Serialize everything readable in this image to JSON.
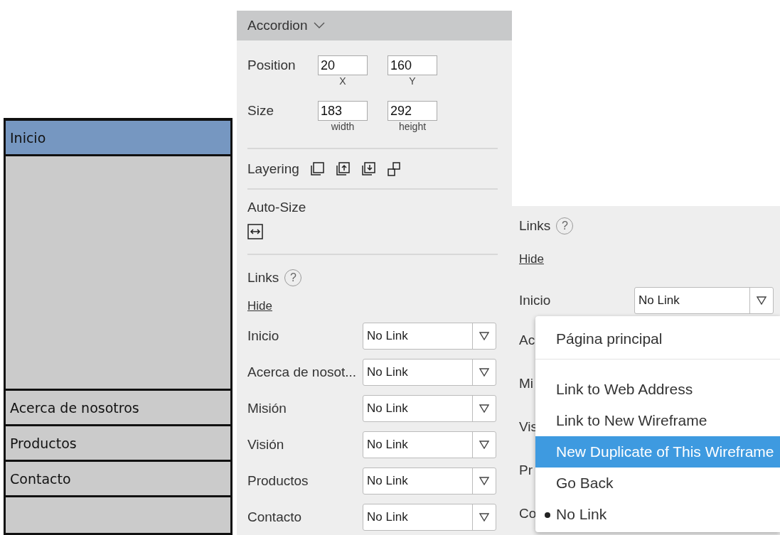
{
  "accordion": {
    "items": [
      {
        "label": "Inicio",
        "selected": true
      },
      {
        "label": "Acerca de nosotros",
        "selected": false
      },
      {
        "label": "Productos",
        "selected": false
      },
      {
        "label": "Contacto",
        "selected": false
      }
    ]
  },
  "inspector": {
    "title": "Accordion",
    "position": {
      "label": "Position",
      "fields": [
        {
          "value": "20",
          "caption": "X"
        },
        {
          "value": "160",
          "caption": "Y"
        }
      ]
    },
    "size": {
      "label": "Size",
      "fields": [
        {
          "value": "183",
          "caption": "width"
        },
        {
          "value": "292",
          "caption": "height"
        }
      ]
    },
    "layering": {
      "label": "Layering"
    },
    "auto_size": {
      "label": "Auto-Size"
    },
    "links": {
      "label": "Links",
      "help": "?",
      "hide": "Hide",
      "rows": [
        {
          "label": "Inicio",
          "value": "No Link"
        },
        {
          "label": "Acerca de nosot...",
          "value": "No Link"
        },
        {
          "label": "Misión",
          "value": "No Link"
        },
        {
          "label": "Visión",
          "value": "No Link"
        },
        {
          "label": "Productos",
          "value": "No Link"
        },
        {
          "label": "Contacto",
          "value": "No Link"
        }
      ]
    }
  },
  "links_detail": {
    "label": "Links",
    "help": "?",
    "hide": "Hide",
    "rows": [
      {
        "label": "Inicio",
        "value": "No Link"
      },
      {
        "label": "Ac"
      },
      {
        "label": "Mi"
      },
      {
        "label": "Vis"
      },
      {
        "label": "Pr"
      },
      {
        "label": "Co"
      }
    ],
    "menu": {
      "pages": [
        {
          "label": "Página principal",
          "selected": false,
          "highlighted": false
        }
      ],
      "actions": [
        {
          "label": "Link to Web Address",
          "selected": false,
          "highlighted": false
        },
        {
          "label": "Link to New Wireframe",
          "selected": false,
          "highlighted": false
        },
        {
          "label": "New Duplicate of This Wireframe",
          "selected": false,
          "highlighted": true
        },
        {
          "label": "Go Back",
          "selected": false,
          "highlighted": false
        },
        {
          "label": "No Link",
          "selected": true,
          "highlighted": false
        }
      ]
    }
  }
}
